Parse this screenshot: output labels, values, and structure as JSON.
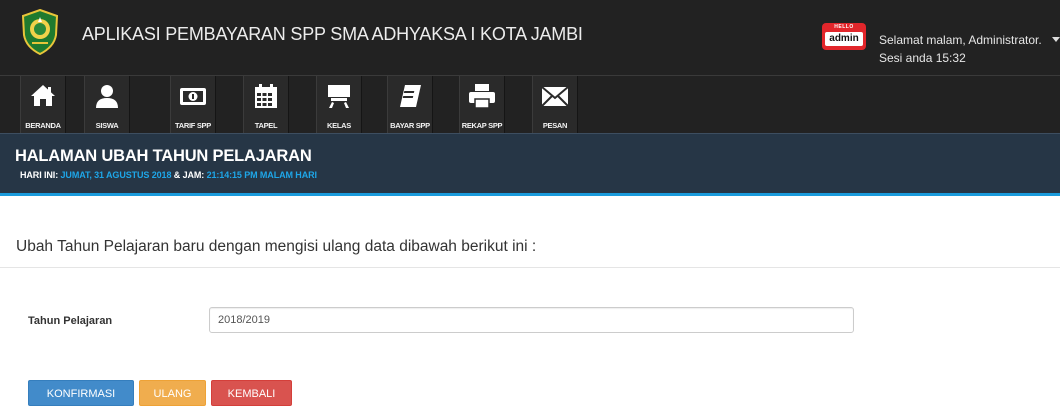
{
  "app": {
    "title": "APLIKASI PEMBAYARAN SPP SMA ADHYAKSA I KOTA JAMBI"
  },
  "user": {
    "badge_top": "HELLO",
    "badge_name": "admin",
    "greeting": "Selamat malam, Administrator.",
    "session": "Sesi anda 15:32"
  },
  "nav": {
    "items": [
      {
        "label": "BERANDA",
        "icon": "home-icon"
      },
      {
        "label": "SISWA",
        "icon": "user-icon"
      },
      {
        "label": "TARIF SPP",
        "icon": "money-icon"
      },
      {
        "label": "TAPEL",
        "icon": "calendar-icon"
      },
      {
        "label": "KELAS",
        "icon": "desk-icon"
      },
      {
        "label": "BAYAR SPP",
        "icon": "book-icon"
      },
      {
        "label": "REKAP SPP",
        "icon": "printer-icon"
      },
      {
        "label": "PESAN",
        "icon": "envelope-icon"
      }
    ]
  },
  "header": {
    "title": "HALAMAN UBAH TAHUN PELAJARAN",
    "day_label": "HARI INI:",
    "day_value": "JUMAT, 31 AGUSTUS 2018",
    "time_label": "& JAM:",
    "time_value": "21:14:15 PM MALAM HARI"
  },
  "form": {
    "instruction": "Ubah Tahun Pelajaran baru dengan mengisi ulang data dibawah berikut ini :",
    "field_label": "Tahun Pelajaran",
    "field_value": "2018/2019",
    "confirm_label": "KONFIRMASI",
    "reset_label": "ULANG",
    "back_label": "KEMBALI"
  },
  "colors": {
    "topbar": "#222222",
    "header_bg": "#263646",
    "accent_blue": "#1ea6e8",
    "btn_primary": "#428bca",
    "btn_warning": "#f0ad4e",
    "btn_danger": "#d9534f"
  }
}
